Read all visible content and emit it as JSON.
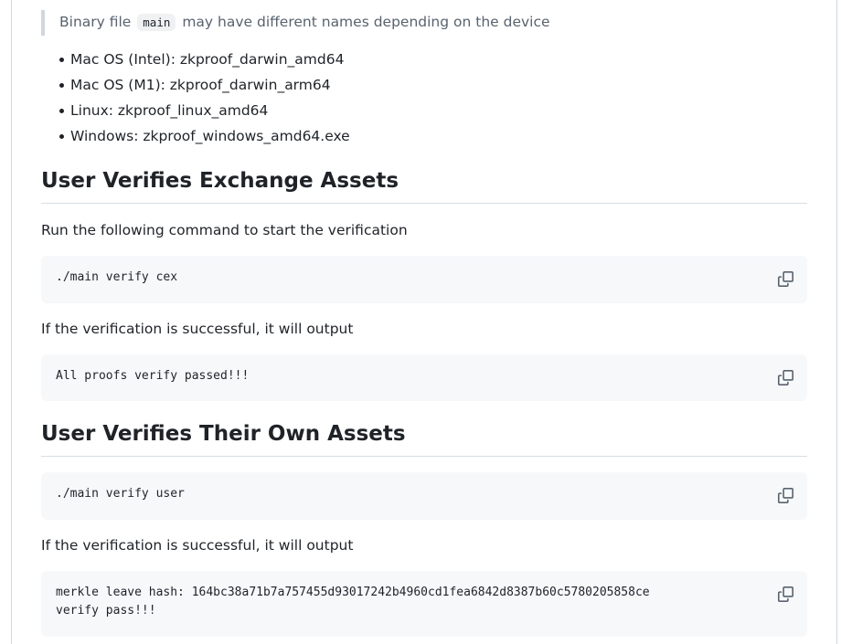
{
  "note": {
    "prefix": "Binary file",
    "code": "main",
    "suffix": "may have different names depending on the device"
  },
  "devices": [
    "Mac OS (Intel): zkproof_darwin_amd64",
    "Mac OS (M1): zkproof_darwin_arm64",
    "Linux: zkproof_linux_amd64",
    "Windows: zkproof_windows_amd64.exe"
  ],
  "section1": {
    "heading": "User Verifies Exchange Assets",
    "intro": "Run the following command to start the verification",
    "command": "./main verify cex",
    "result_intro": "If the verification is successful, it will output",
    "output": "All proofs verify passed!!!"
  },
  "section2": {
    "heading": "User Verifies Their Own Assets",
    "command": "./main verify user",
    "result_intro": "If the verification is successful, it will output",
    "output_line1": "merkle leave hash: 164bc38a71b7a757455d93017242b4960cd1fea6842d8387b60c5780205858ce",
    "output_line2": "verify pass!!!"
  },
  "icons": {
    "copy": "copy-icon"
  },
  "colors": {
    "text": "#1f2328",
    "muted": "#59636e",
    "code_bg": "#f6f8fa",
    "border": "#d0d7de"
  }
}
